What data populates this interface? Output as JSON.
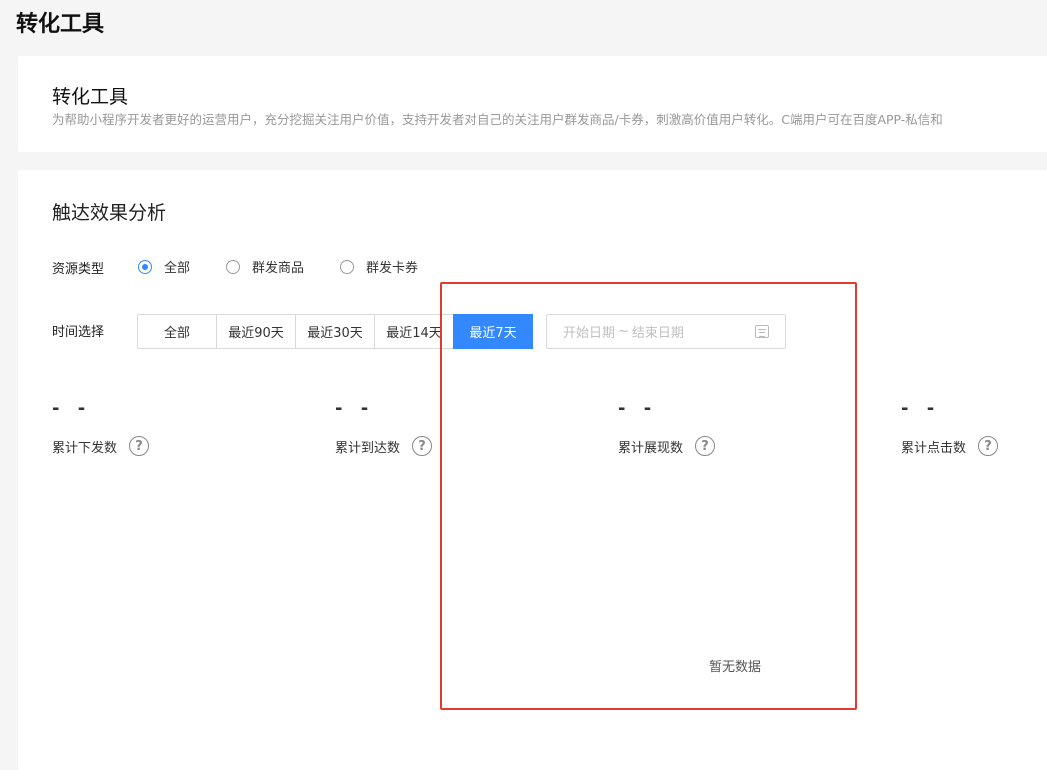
{
  "page": {
    "title": "转化工具"
  },
  "intro": {
    "title": "转化工具",
    "description": "为帮助小程序开发者更好的运营用户，充分挖掘关注用户价值，支持开发者对自己的关注用户群发商品/卡券，刺激高价值用户转化。C端用户可在百度APP-私信和"
  },
  "analysis": {
    "title": "触达效果分析",
    "resource_label": "资源类型",
    "resource_options": [
      "全部",
      "群发商品",
      "群发卡券"
    ],
    "resource_selected": "全部",
    "time_label": "时间选择",
    "time_options": [
      "全部",
      "最近90天",
      "最近30天",
      "最近14天",
      "最近7天"
    ],
    "time_selected": "最近7天",
    "date_range": {
      "start_placeholder": "开始日期",
      "separator": "~",
      "end_placeholder": "结束日期",
      "icon": "calendar-icon"
    },
    "metrics": [
      {
        "value": "- -",
        "label": "累计下发数",
        "icon": "help-circle-icon"
      },
      {
        "value": "- -",
        "label": "累计到达数",
        "icon": "help-circle-icon"
      },
      {
        "value": "- -",
        "label": "累计展现数",
        "icon": "help-circle-icon"
      },
      {
        "value": "- -",
        "label": "累计点击数",
        "icon": "help-circle-icon"
      }
    ],
    "empty_text": "暂无数据"
  },
  "colors": {
    "accent": "#3388ff",
    "highlight": "#e23b2e",
    "background": "#f5f5f6"
  }
}
